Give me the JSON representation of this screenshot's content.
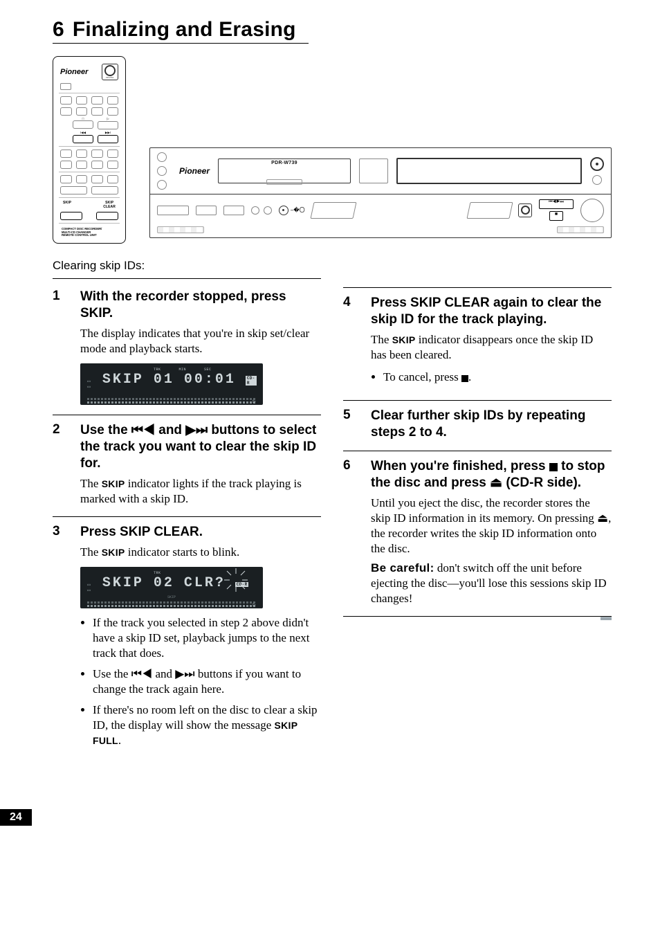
{
  "page_number": "24",
  "heading": {
    "chapter": "6",
    "title": "Finalizing and Erasing"
  },
  "diagrams": {
    "remote": {
      "brand": "Pioneer",
      "skip_label": "SKIP",
      "skip_clear_label": "SKIP\nCLEAR",
      "footer_line1": "COMPACT DISC RECORDER/",
      "footer_line2": "MULTI-CD CHANGER",
      "footer_line3": "REMOTE CONTROL UNIT",
      "nav_prev": "I◀◀",
      "nav_next": "▶▶I"
    },
    "deck": {
      "brand": "Pioneer",
      "model": "PDR-W739"
    }
  },
  "intro": "Clearing skip IDs:",
  "skip_indicator": "SKIP",
  "skip_full": "SKIP FULL",
  "symbols": {
    "prev": "⏮◀",
    "next": "▶⏭",
    "stop": "■",
    "eject": "⏏"
  },
  "lcd1": {
    "labels_top_left": "",
    "trk": "TRK",
    "min": "MIN",
    "sec": "SEC",
    "text": "SKIP",
    "track": "01",
    "time": "00:01",
    "tag": "CD-R"
  },
  "lcd2": {
    "trk": "TRK",
    "text": "SKIP",
    "track": "02",
    "right": "CLR?",
    "tag": "CD-R",
    "skip_label": "SKIP"
  },
  "steps_left": [
    {
      "num": "1",
      "head": "With the recorder stopped, press SKIP.",
      "body": "The display indicates that you're in skip set/clear mode and playback starts."
    },
    {
      "num": "2",
      "head_parts": [
        "Use the ",
        " and ",
        " buttons to select  the track you want to clear the skip ID for."
      ],
      "body_parts": [
        " The ",
        " indicator lights if the track playing is marked with a skip ID."
      ]
    },
    {
      "num": "3",
      "head": "Press SKIP CLEAR.",
      "body_parts": [
        "The ",
        " indicator starts to blink."
      ],
      "bullets": [
        "If the track you selected in step 2 above didn't have a skip ID set, playback jumps to the next track that does.",
        [
          "Use the ",
          " and ",
          " buttons if you want to change the track again here."
        ],
        [
          "If there's no room left on the disc to clear a skip ID, the display will show the message ",
          "."
        ]
      ]
    }
  ],
  "steps_right": [
    {
      "num": "4",
      "head": "Press SKIP CLEAR again to clear the skip ID for the track playing.",
      "body_parts": [
        "The ",
        " indicator disappears once the skip ID has been cleared."
      ],
      "bullets": [
        [
          "To cancel, press ",
          "."
        ]
      ]
    },
    {
      "num": "5",
      "head": "Clear further skip IDs by repeating steps 2 to 4."
    },
    {
      "num": "6",
      "head_parts": [
        "When you're finished, press ",
        " to stop the disc and press ",
        " (CD-R side)."
      ],
      "body_parts": [
        "Until you eject the disc, the recorder stores the skip ID information in its memory. On pressing ",
        ", the recorder writes the skip ID information onto the disc."
      ],
      "warn_label": "Be careful:",
      "warn_body": " don't switch off the unit before ejecting the disc—you'll lose this sessions skip ID changes!"
    }
  ]
}
